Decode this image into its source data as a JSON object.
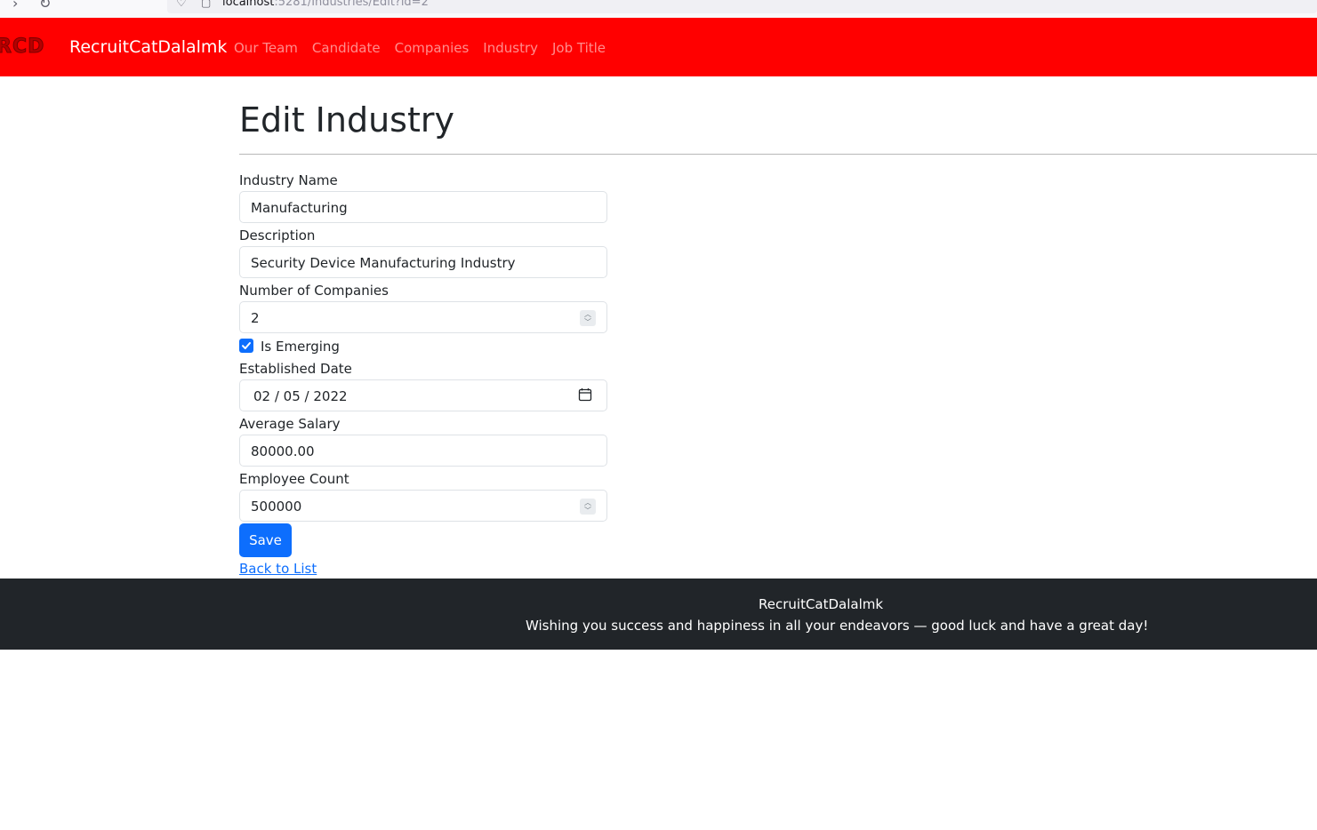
{
  "browser": {
    "url_host": "localhost",
    "url_path": ":5281/Industries/Edit?id=2"
  },
  "navbar": {
    "logo_text": "RCD",
    "brand": "RecruitCatDalalmk",
    "background_color": "#ff0000",
    "links": [
      "Our Team",
      "Candidate",
      "Companies",
      "Industry",
      "Job Title"
    ]
  },
  "page": {
    "title": "Edit Industry"
  },
  "form": {
    "industry_name": {
      "label": "Industry Name",
      "value": "Manufacturing"
    },
    "description": {
      "label": "Description",
      "value": "Security Device Manufacturing Industry"
    },
    "number_of_companies": {
      "label": "Number of Companies",
      "value": "2"
    },
    "is_emerging": {
      "label": "Is Emerging",
      "checked": true
    },
    "established_date": {
      "label": "Established Date",
      "value": "02 / 05 / 2022"
    },
    "average_salary": {
      "label": "Average Salary",
      "value": "80000.00"
    },
    "employee_count": {
      "label": "Employee Count",
      "value": "500000"
    },
    "save_label": "Save",
    "back_label": "Back to List",
    "accent_color": "#0d6efd"
  },
  "footer": {
    "title": "RecruitCatDalalmk",
    "message": "Wishing you success and happiness in all your endeavors — good luck and have a great day!",
    "background_color": "#212529"
  }
}
